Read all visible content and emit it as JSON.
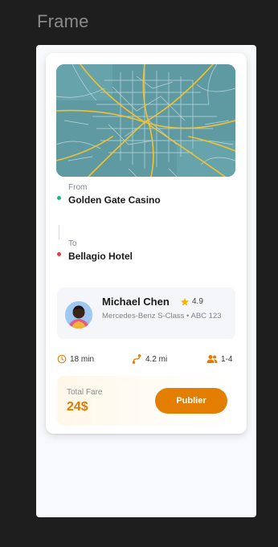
{
  "canvas": {
    "label": "Frame"
  },
  "trip": {
    "from_label": "From",
    "from_value": "Golden Gate Casino",
    "to_label": "To",
    "to_value": "Bellagio Hotel"
  },
  "driver": {
    "name": "Michael Chen",
    "rating": "4.9",
    "vehicle": "Mercedes-Benz S-Class • ABC 123"
  },
  "stats": {
    "duration": "18 min",
    "distance": "4.2 mi",
    "passengers": "1-4"
  },
  "fare": {
    "label": "Total Fare",
    "value": "24$",
    "button_label": "Publier"
  },
  "colors": {
    "accent": "#e47e00",
    "from_dot": "#1bb583",
    "to_dot": "#e53e3e"
  },
  "icons": [
    "map",
    "star-icon",
    "clock-icon",
    "route-icon",
    "users-icon"
  ]
}
